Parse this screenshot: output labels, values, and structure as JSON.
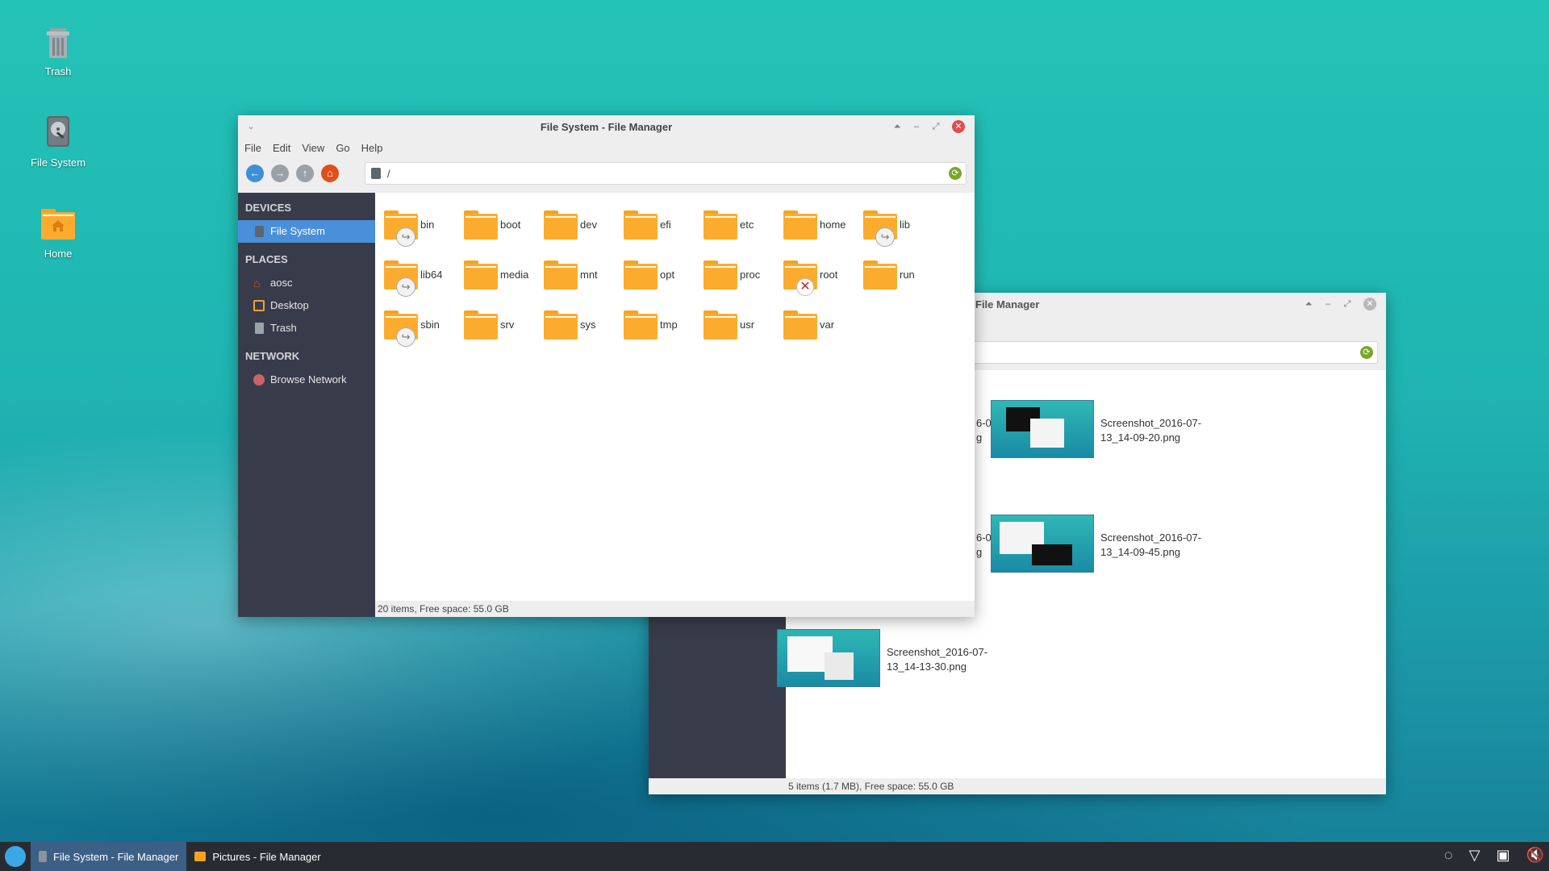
{
  "desktop": {
    "icons": [
      {
        "label": "Trash",
        "icon": "trash-icon"
      },
      {
        "label": "File System",
        "icon": "drive-icon"
      },
      {
        "label": "Home",
        "icon": "home-folder-icon"
      }
    ]
  },
  "win_front": {
    "title": "File System - File Manager",
    "menu": [
      "File",
      "Edit",
      "View",
      "Go",
      "Help"
    ],
    "path": "/",
    "sidebar": {
      "devices_head": "DEVICES",
      "devices": [
        {
          "label": "File System",
          "icon": "drive-icon"
        }
      ],
      "places_head": "PLACES",
      "places": [
        {
          "label": "aosc",
          "icon": "home-icon"
        },
        {
          "label": "Desktop",
          "icon": "desktop-icon"
        },
        {
          "label": "Trash",
          "icon": "trash-icon"
        }
      ],
      "network_head": "NETWORK",
      "network": [
        {
          "label": "Browse Network",
          "icon": "network-icon"
        }
      ]
    },
    "folders": [
      {
        "name": "bin",
        "badge": "link"
      },
      {
        "name": "boot",
        "badge": ""
      },
      {
        "name": "dev",
        "badge": ""
      },
      {
        "name": "efi",
        "badge": ""
      },
      {
        "name": "etc",
        "badge": ""
      },
      {
        "name": "home",
        "badge": ""
      },
      {
        "name": "lib",
        "badge": "link"
      },
      {
        "name": "lib64",
        "badge": "link"
      },
      {
        "name": "media",
        "badge": ""
      },
      {
        "name": "mnt",
        "badge": ""
      },
      {
        "name": "opt",
        "badge": ""
      },
      {
        "name": "proc",
        "badge": ""
      },
      {
        "name": "root",
        "badge": "locked"
      },
      {
        "name": "run",
        "badge": ""
      },
      {
        "name": "sbin",
        "badge": "link"
      },
      {
        "name": "srv",
        "badge": ""
      },
      {
        "name": "sys",
        "badge": ""
      },
      {
        "name": "tmp",
        "badge": ""
      },
      {
        "name": "usr",
        "badge": ""
      },
      {
        "name": "var",
        "badge": ""
      }
    ],
    "status": "20 items, Free space: 55.0 GB"
  },
  "win_back": {
    "title_fragment": "File Manager",
    "partial_names": [
      "6-07-",
      "g",
      "6-07-",
      "g"
    ],
    "files": [
      {
        "line1": "Screenshot_2016-07-",
        "line2": "13_14-09-20.png"
      },
      {
        "line1": "Screenshot_2016-07-",
        "line2": "13_14-09-45.png"
      },
      {
        "line1": "Screenshot_2016-07-",
        "line2": "13_14-13-30.png"
      }
    ],
    "status": "5 items (1.7 MB), Free space: 55.0 GB"
  },
  "taskbar": {
    "tasks": [
      {
        "label": "File System - File Manager",
        "icon": "drive-icon",
        "active": true
      },
      {
        "label": "Pictures - File Manager",
        "icon": "pictures-icon",
        "active": false
      }
    ],
    "tray": [
      "clock-icon",
      "wifi-icon",
      "clipboard-icon",
      "volume-muted-icon"
    ]
  },
  "colors": {
    "accent": "#4a8fd9",
    "folder": "#fbac2e",
    "sidebar": "#383c4a",
    "close": "#e34c4c"
  }
}
